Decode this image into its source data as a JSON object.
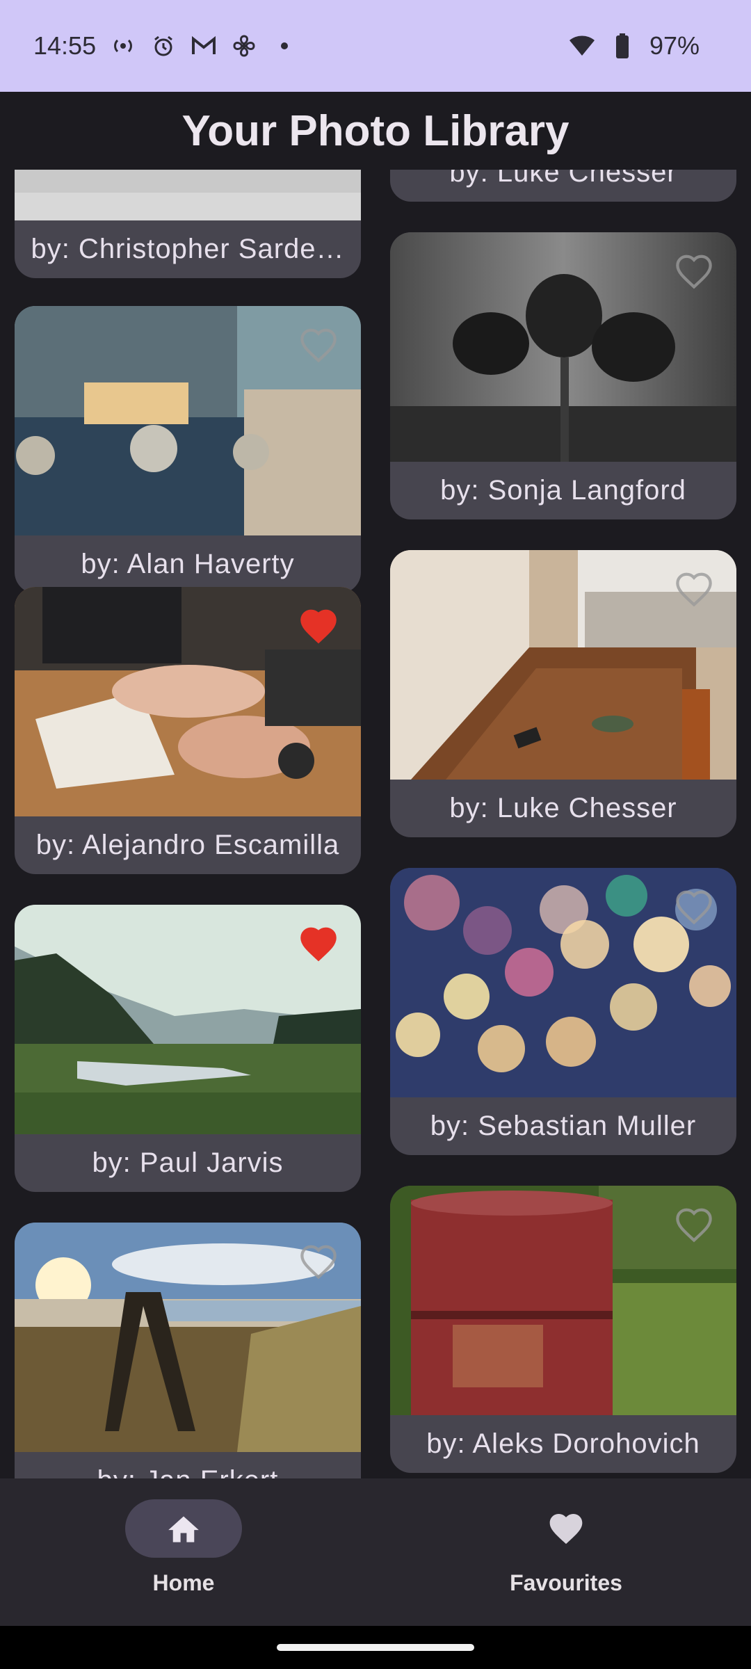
{
  "status_bar": {
    "time": "14:55",
    "battery": "97%",
    "icons": [
      "hotspot-icon",
      "alarm-icon",
      "gmail-icon",
      "fan-icon",
      "dot-icon",
      "wifi-icon",
      "battery-icon"
    ]
  },
  "app": {
    "title": "Your Photo Library"
  },
  "photos": {
    "left": [
      {
        "caption": "by: Christopher Sarde…",
        "favourite": false
      },
      {
        "caption": "by: Alan Haverty",
        "favourite": false
      },
      {
        "caption": "by: Alejandro Escamilla",
        "favourite": true
      },
      {
        "caption": "by: Paul Jarvis",
        "favourite": true
      },
      {
        "caption": "by: Jan Erkert",
        "favourite": false
      }
    ],
    "right": [
      {
        "caption": "by: Luke Chesser",
        "favourite": false
      },
      {
        "caption": "by: Sonja Langford",
        "favourite": false
      },
      {
        "caption": "by: Luke Chesser",
        "favourite": false
      },
      {
        "caption": "by: Sebastian Muller",
        "favourite": false
      },
      {
        "caption": "by: Aleks Dorohovich",
        "favourite": false
      }
    ]
  },
  "nav": {
    "home_label": "Home",
    "favourites_label": "Favourites",
    "selected": "home"
  },
  "colors": {
    "status_bar": "#d0c7f8",
    "background": "#1c1b20",
    "card": "#47454f",
    "nav_background": "#29272e",
    "nav_pill": "#4a4658",
    "heart_active": "#e53226"
  }
}
